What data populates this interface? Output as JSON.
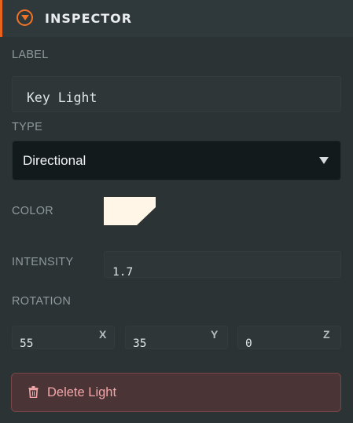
{
  "header": {
    "title": "INSPECTOR",
    "icon": "chevron-down-circle-icon",
    "accent": "#e8631c"
  },
  "label_field": {
    "label": "LABEL",
    "value": "Key Light"
  },
  "type_field": {
    "label": "TYPE",
    "value": "Directional"
  },
  "color_field": {
    "label": "COLOR",
    "value": "#fff6e8"
  },
  "intensity_field": {
    "label": "INTENSITY",
    "value": "1.7"
  },
  "rotation_field": {
    "label": "ROTATION",
    "x": {
      "axis": "X",
      "value": "55"
    },
    "y": {
      "axis": "Y",
      "value": "35"
    },
    "z": {
      "axis": "Z",
      "value": "0"
    }
  },
  "delete_button": {
    "label": "Delete Light",
    "icon": "trash-icon"
  }
}
